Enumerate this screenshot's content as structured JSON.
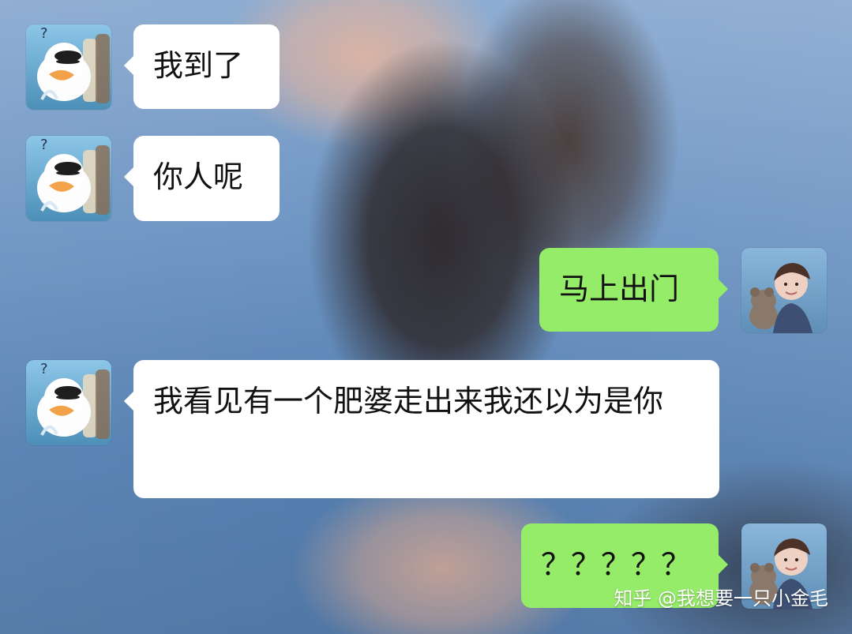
{
  "chat": {
    "messages": [
      {
        "sender": "left",
        "text": "我到了"
      },
      {
        "sender": "left",
        "text": "你人呢"
      },
      {
        "sender": "right",
        "text": "马上出门"
      },
      {
        "sender": "left",
        "text": "我看见有一个肥婆走出来我还以为是你"
      },
      {
        "sender": "right",
        "text": "？？？？？"
      }
    ]
  },
  "watermark": {
    "text": "知乎 @我想要一只小金毛"
  },
  "icons": {
    "left_avatar": "duck-question-avatar-icon",
    "right_avatar": "boy-with-teddy-bear-avatar-icon"
  },
  "colors": {
    "incoming_bubble": "#ffffff",
    "outgoing_bubble": "#95ec69",
    "watermark": "#ffffff"
  }
}
